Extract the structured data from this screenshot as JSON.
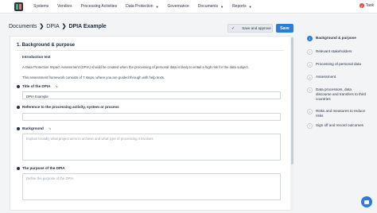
{
  "nav": {
    "items": [
      "Systems",
      "Vendors",
      "Processing Activities",
      "Data Protection",
      "Governance",
      "Documents",
      "Reports"
    ],
    "tasks_count": "2",
    "tasks_label": "Task"
  },
  "breadcrumb": {
    "items": [
      "Documents",
      "DPIA"
    ],
    "current": "DPIA Example"
  },
  "actions": {
    "approve_label": "Save and approve",
    "save_label": "Save"
  },
  "form": {
    "section_title": "1. Background & purpose",
    "intro_title": "Introduction text",
    "intro_text_1": "A Data Protection Impact Assessment (DPIA) should be created when the processing of personal data is likely to entail a high risk for the data subject.",
    "intro_text_2": "This assessment framework consists of 7 steps, where you are guided through with help texts.",
    "questions": [
      {
        "label": "Title of the DPIA",
        "value": "DPIA Example",
        "placeholder": ""
      },
      {
        "label": "Reference to the processing activity, system or process",
        "value": "",
        "placeholder": ""
      },
      {
        "label": "Background",
        "value": "",
        "placeholder": "Explain broadly what project aims to achieve and what type of processing it involves"
      },
      {
        "label": "The purpose of the DPIA",
        "value": "",
        "placeholder": "Define the purpose of the DPIA"
      }
    ]
  },
  "steps": [
    {
      "num": "1",
      "label": "Background & purpose"
    },
    {
      "num": "2",
      "label": "Relevant stakeholders"
    },
    {
      "num": "3",
      "label": "Processing of personal data"
    },
    {
      "num": "4",
      "label": "Assessment"
    },
    {
      "num": "5",
      "label": "Data processors, data discourse and transfers to third countries"
    },
    {
      "num": "6",
      "label": "Risks and measures to reduce risks"
    },
    {
      "num": "7",
      "label": "Sign off and record outcomes"
    }
  ]
}
